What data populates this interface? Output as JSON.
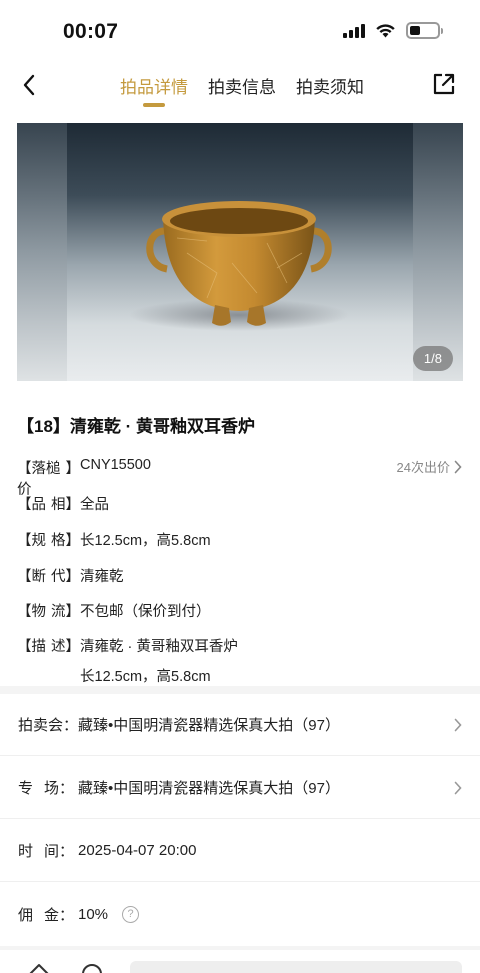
{
  "status_bar": {
    "time": "00:07"
  },
  "nav": {
    "tabs": [
      {
        "label": "拍品详情",
        "active": true
      },
      {
        "label": "拍卖信息",
        "active": false
      },
      {
        "label": "拍卖须知",
        "active": false
      }
    ],
    "accent_color": "#c49a3e"
  },
  "gallery": {
    "counter": "1/8"
  },
  "lot": {
    "title": "【18】清雍乾 · 黄哥釉双耳香炉",
    "bids": "24次出价",
    "specs": [
      {
        "label_open": "【落槌价",
        "value": "CNY15500"
      },
      {
        "label_a": "【品",
        "label_b": "相】",
        "value": "全品"
      },
      {
        "label_a": "【规",
        "label_b": "格】",
        "value": "长12.5cm，高5.8cm"
      },
      {
        "label_a": "【断",
        "label_b": "代】",
        "value": "清雍乾"
      },
      {
        "label_a": "【物",
        "label_b": "流】",
        "value": "不包邮（保价到付）"
      },
      {
        "label_a": "【描",
        "label_b": "述】",
        "value": "清雍乾 · 黄哥釉双耳香炉",
        "value2": "长12.5cm，高5.8cm"
      }
    ]
  },
  "auction": {
    "rows": [
      {
        "label_a": "拍卖会",
        "value": "藏臻•中国明清瓷器精选保真大拍（97）"
      },
      {
        "label_a": "专",
        "label_b": "场",
        "value": "藏臻•中国明清瓷器精选保真大拍（97）"
      },
      {
        "label_a": "时",
        "label_b": "间",
        "value": "2025-04-07 20:00"
      },
      {
        "label_a": "佣",
        "label_b": "金",
        "value": "10%"
      }
    ]
  },
  "icons": {
    "back": "chevron-left-icon",
    "share": "share-icon",
    "chevron": "chevron-right-icon",
    "help": "question-circle-icon"
  }
}
